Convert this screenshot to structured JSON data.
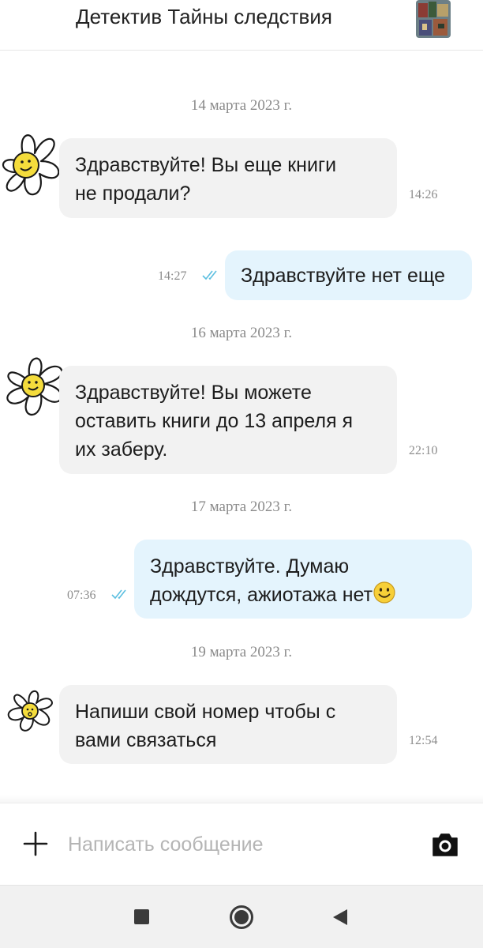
{
  "header": {
    "title": "Детектив Тайны следствия"
  },
  "messages": [
    {
      "date": "14 марта 2023 г."
    },
    {
      "direction": "in",
      "lines": [
        "Здравствуйте! Вы еще книги",
        "не продали?"
      ],
      "time": "14:26"
    },
    {
      "direction": "out",
      "lines": [
        "Здравствуйте нет еще"
      ],
      "time": "14:27"
    },
    {
      "date": "16 марта 2023 г."
    },
    {
      "direction": "in",
      "lines": [
        "Здравствуйте! Вы можете",
        "оставить книги до 13 апреля я",
        "их заберу."
      ],
      "time": "22:10"
    },
    {
      "date": "17 марта 2023 г."
    },
    {
      "direction": "out",
      "lines": [
        "Здравствуйте. Думаю",
        "дождутся, ажиотажа нет"
      ],
      "time": "07:36"
    },
    {
      "date": "19 марта 2023 г."
    },
    {
      "direction": "in",
      "lines": [
        "Напиши свой номер чтобы с",
        "вами связаться"
      ],
      "time": "12:54"
    }
  ],
  "composer": {
    "placeholder": "Написать сообщение",
    "add_icon": "plus-icon",
    "camera_icon": "camera-icon"
  },
  "navbar": {
    "icons": [
      "recent-apps-icon",
      "home-icon",
      "back-icon"
    ]
  },
  "colors": {
    "incoming_bubble": "#f2f2f2",
    "outgoing_bubble": "#e4f4fd",
    "read_ticks": "#5cbfe0",
    "muted_text": "#8a8a8a",
    "placeholder": "#b5b5b5"
  }
}
